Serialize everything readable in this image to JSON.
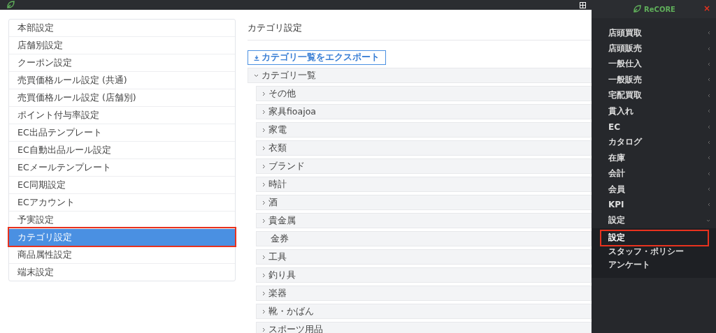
{
  "settings_menu": [
    {
      "label": "本部設定",
      "selected": false,
      "highlighted": false
    },
    {
      "label": "店舗別設定",
      "selected": false,
      "highlighted": false
    },
    {
      "label": "クーポン設定",
      "selected": false,
      "highlighted": false
    },
    {
      "label": "売買価格ルール設定 (共通)",
      "selected": false,
      "highlighted": false
    },
    {
      "label": "売買価格ルール設定 (店舗別)",
      "selected": false,
      "highlighted": false
    },
    {
      "label": "ポイント付与率設定",
      "selected": false,
      "highlighted": false
    },
    {
      "label": "EC出品テンプレート",
      "selected": false,
      "highlighted": false
    },
    {
      "label": "EC自動出品ルール設定",
      "selected": false,
      "highlighted": false
    },
    {
      "label": "ECメールテンプレート",
      "selected": false,
      "highlighted": false
    },
    {
      "label": "EC同期設定",
      "selected": false,
      "highlighted": false
    },
    {
      "label": "ECアカウント",
      "selected": false,
      "highlighted": false
    },
    {
      "label": "予実設定",
      "selected": false,
      "highlighted": false
    },
    {
      "label": "カテゴリ設定",
      "selected": true,
      "highlighted": true
    },
    {
      "label": "商品属性設定",
      "selected": false,
      "highlighted": false
    },
    {
      "label": "端末設定",
      "selected": false,
      "highlighted": false
    }
  ],
  "page_title": "カテゴリ設定",
  "export_button": "カテゴリ一覧をエクスポート",
  "category_tree": {
    "label": "カテゴリ一覧",
    "expanded": true,
    "children": [
      {
        "label": "その他",
        "expandable": true
      },
      {
        "label": "家具fioajoa",
        "expandable": true
      },
      {
        "label": "家電",
        "expandable": true
      },
      {
        "label": "衣類",
        "expandable": true
      },
      {
        "label": "ブランド",
        "expandable": true
      },
      {
        "label": "時計",
        "expandable": true
      },
      {
        "label": "酒",
        "expandable": true
      },
      {
        "label": "貴金属",
        "expandable": true
      },
      {
        "label": "金券",
        "expandable": false
      },
      {
        "label": "工具",
        "expandable": true
      },
      {
        "label": "釣り具",
        "expandable": true
      },
      {
        "label": "楽器",
        "expandable": true
      },
      {
        "label": "靴・かばん",
        "expandable": true
      },
      {
        "label": "スポーツ用品",
        "expandable": true
      }
    ]
  },
  "drawer": {
    "brand": "ReCORE",
    "close": "×",
    "items": [
      {
        "label": "店頭買取",
        "expanded": false
      },
      {
        "label": "店頭販売",
        "expanded": false
      },
      {
        "label": "一般仕入",
        "expanded": false
      },
      {
        "label": "一般販売",
        "expanded": false
      },
      {
        "label": "宅配買取",
        "expanded": false
      },
      {
        "label": "貫入れ",
        "expanded": false
      },
      {
        "label": "EC",
        "expanded": false
      },
      {
        "label": "カタログ",
        "expanded": false
      },
      {
        "label": "在庫",
        "expanded": false
      },
      {
        "label": "会計",
        "expanded": false
      },
      {
        "label": "会員",
        "expanded": false
      },
      {
        "label": "KPI",
        "expanded": false
      },
      {
        "label": "設定",
        "expanded": true,
        "children": [
          {
            "label": "設定",
            "selected": true,
            "highlighted": true
          },
          {
            "label": "スタッフ・ポリシー",
            "selected": false,
            "highlighted": false
          },
          {
            "label": "アンケート",
            "selected": false,
            "highlighted": false
          }
        ]
      }
    ]
  }
}
